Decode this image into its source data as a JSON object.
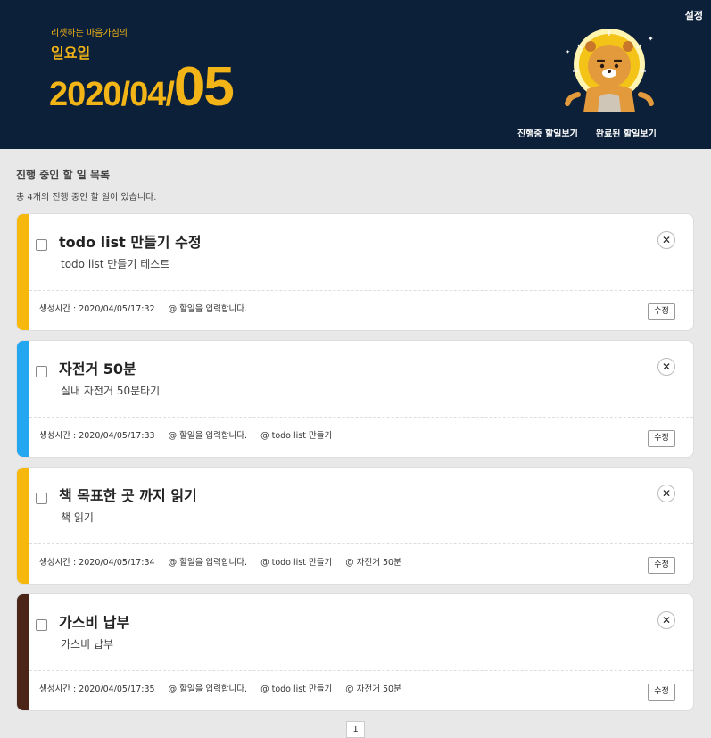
{
  "header": {
    "settings_label": "설정",
    "slogan": "리셋하는 마음가짐의",
    "weekday": "일요일",
    "date_prefix": "2020/04/",
    "date_day": "05",
    "nav": [
      "진행중 할일보기",
      "완료된 할일보기"
    ],
    "mascot_icon": "lion-mascot-icon"
  },
  "section": {
    "title": "진행 중인 할 일 목록",
    "summary": "총 4개의 진행 중인 할 일이 있습니다."
  },
  "todos": [
    {
      "title": "todo list 만들기 수정",
      "desc": "todo list 만들기 테스트",
      "meta": [
        "생성시간 : 2020/04/05/17:32",
        "@ 할일을 입력합니다."
      ],
      "edit_label": "수정",
      "close_label": "✕",
      "color": "#f6b80c"
    },
    {
      "title": "자전거 50분",
      "desc": "실내 자전거 50분타기",
      "meta": [
        "생성시간 : 2020/04/05/17:33",
        "@ 할일을 입력합니다.",
        "@ todo list 만들기"
      ],
      "edit_label": "수정",
      "close_label": "✕",
      "color": "#22a7f0"
    },
    {
      "title": "책 목표한 곳 까지 읽기",
      "desc": "책 읽기",
      "meta": [
        "생성시간 : 2020/04/05/17:34",
        "@ 할일을 입력합니다.",
        "@ todo list 만들기",
        "@ 자전거 50분"
      ],
      "edit_label": "수정",
      "close_label": "✕",
      "color": "#f6b80c"
    },
    {
      "title": "가스비 납부",
      "desc": "가스비 납부",
      "meta": [
        "생성시간 : 2020/04/05/17:35",
        "@ 할일을 입력합니다.",
        "@ todo list 만들기",
        "@ 자전거 50분"
      ],
      "edit_label": "수정",
      "close_label": "✕",
      "color": "#4a2518"
    }
  ],
  "pagination": {
    "current": "1"
  }
}
